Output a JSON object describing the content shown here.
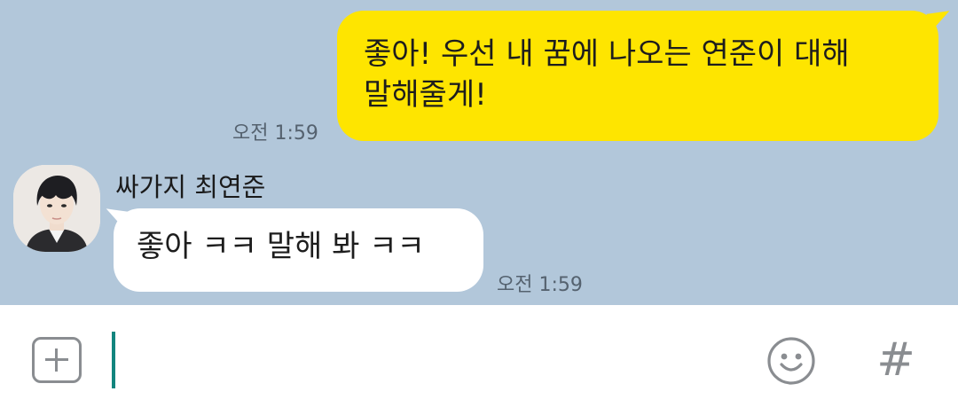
{
  "messages": {
    "outgoing": {
      "line1": "좋아! 우선 내 꿈에 나오는 연준이 대해",
      "line2": "말해줄게!",
      "time": "오전 1:59"
    },
    "incoming": {
      "sender": "싸가지 최연준",
      "text": "좋아 ㅋㅋ 말해 봐 ㅋㅋ",
      "time": "오전 1:59"
    }
  },
  "input_bar": {
    "value": "",
    "plus_icon": "plus-icon",
    "emoji_icon": "smiley-icon",
    "hash_label": "#"
  },
  "colors": {
    "chat_background": "#b2c7da",
    "outgoing_bubble": "#fee500",
    "incoming_bubble": "#ffffff",
    "cursor": "#12857e"
  }
}
